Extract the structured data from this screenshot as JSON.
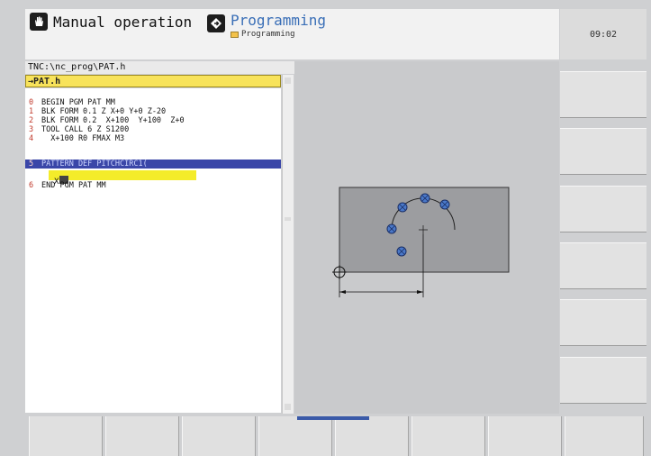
{
  "header": {
    "manual_mode": "Manual operation",
    "prog_mode": "Programming",
    "prog_sub": "Programming",
    "clock": "09:02"
  },
  "program": {
    "path": "TNC:\\nc_prog\\PAT.h",
    "file_tab": "→PAT.h",
    "lines": [
      {
        "n": "0",
        "text": "BEGIN PGM PAT MM"
      },
      {
        "n": "1",
        "text": "BLK FORM 0.1 Z X+0 Y+0 Z-20"
      },
      {
        "n": "2",
        "text": "BLK FORM 0.2  X+100  Y+100  Z+0"
      },
      {
        "n": "3",
        "text": "TOOL CALL 6 Z S1200"
      },
      {
        "n": "4",
        "text": "  X+100 R0 FMAX M3"
      },
      {
        "n": "5",
        "text": "PATTERN DEF PITCHCIRC1("
      },
      {
        "n": "6",
        "text": "END PGM PAT MM"
      }
    ],
    "edit_value": "X"
  },
  "colors": {
    "accent_blue": "#3a6fb7",
    "selection": "#3a46a8",
    "highlight_yellow": "#f4ec2a"
  }
}
